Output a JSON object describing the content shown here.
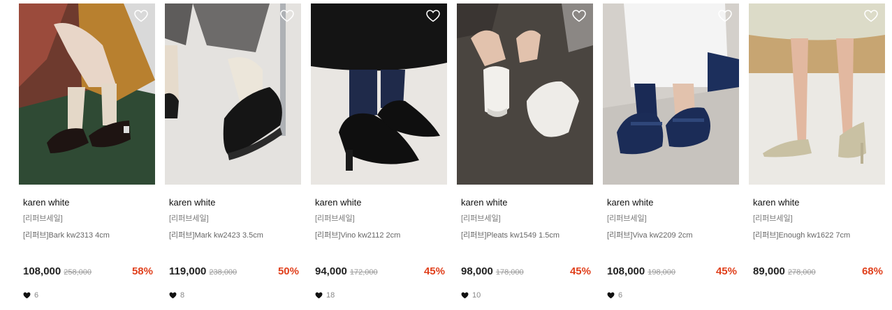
{
  "products": [
    {
      "brand": "karen white",
      "tag": "[리퍼브세일]",
      "title": "[리퍼브]Bark kw2313 4cm",
      "price": "108,000",
      "original_price": "258,000",
      "discount": "58%",
      "likes": "6",
      "image_icon": "photo-loafer-mary-jane-brown"
    },
    {
      "brand": "karen white",
      "tag": "[리퍼브세일]",
      "title": "[리퍼브]Mark kw2423 3.5cm",
      "price": "119,000",
      "original_price": "238,000",
      "discount": "50%",
      "likes": "8",
      "image_icon": "photo-black-loafer"
    },
    {
      "brand": "karen white",
      "tag": "[리퍼브세일]",
      "title": "[리퍼브]Vino kw2112 2cm",
      "price": "94,000",
      "original_price": "172,000",
      "discount": "45%",
      "likes": "18",
      "image_icon": "photo-black-pointed-flat"
    },
    {
      "brand": "karen white",
      "tag": "[리퍼브세일]",
      "title": "[리퍼브]Pleats kw1549 1.5cm",
      "price": "98,000",
      "original_price": "178,000",
      "discount": "45%",
      "likes": "10",
      "image_icon": "photo-white-oxford"
    },
    {
      "brand": "karen white",
      "tag": "[리퍼브세일]",
      "title": "[리퍼브]Viva kw2209 2cm",
      "price": "108,000",
      "original_price": "198,000",
      "discount": "45%",
      "likes": "6",
      "image_icon": "photo-navy-mary-jane"
    },
    {
      "brand": "karen white",
      "tag": "[리퍼브세일]",
      "title": "[리퍼브]Enough kw1622 7cm",
      "price": "89,000",
      "original_price": "278,000",
      "discount": "68%",
      "likes": "0",
      "image_icon": "photo-beige-pump"
    }
  ],
  "colors": {
    "discount": "#e0401c",
    "price": "#222222",
    "original_price": "#999999"
  }
}
